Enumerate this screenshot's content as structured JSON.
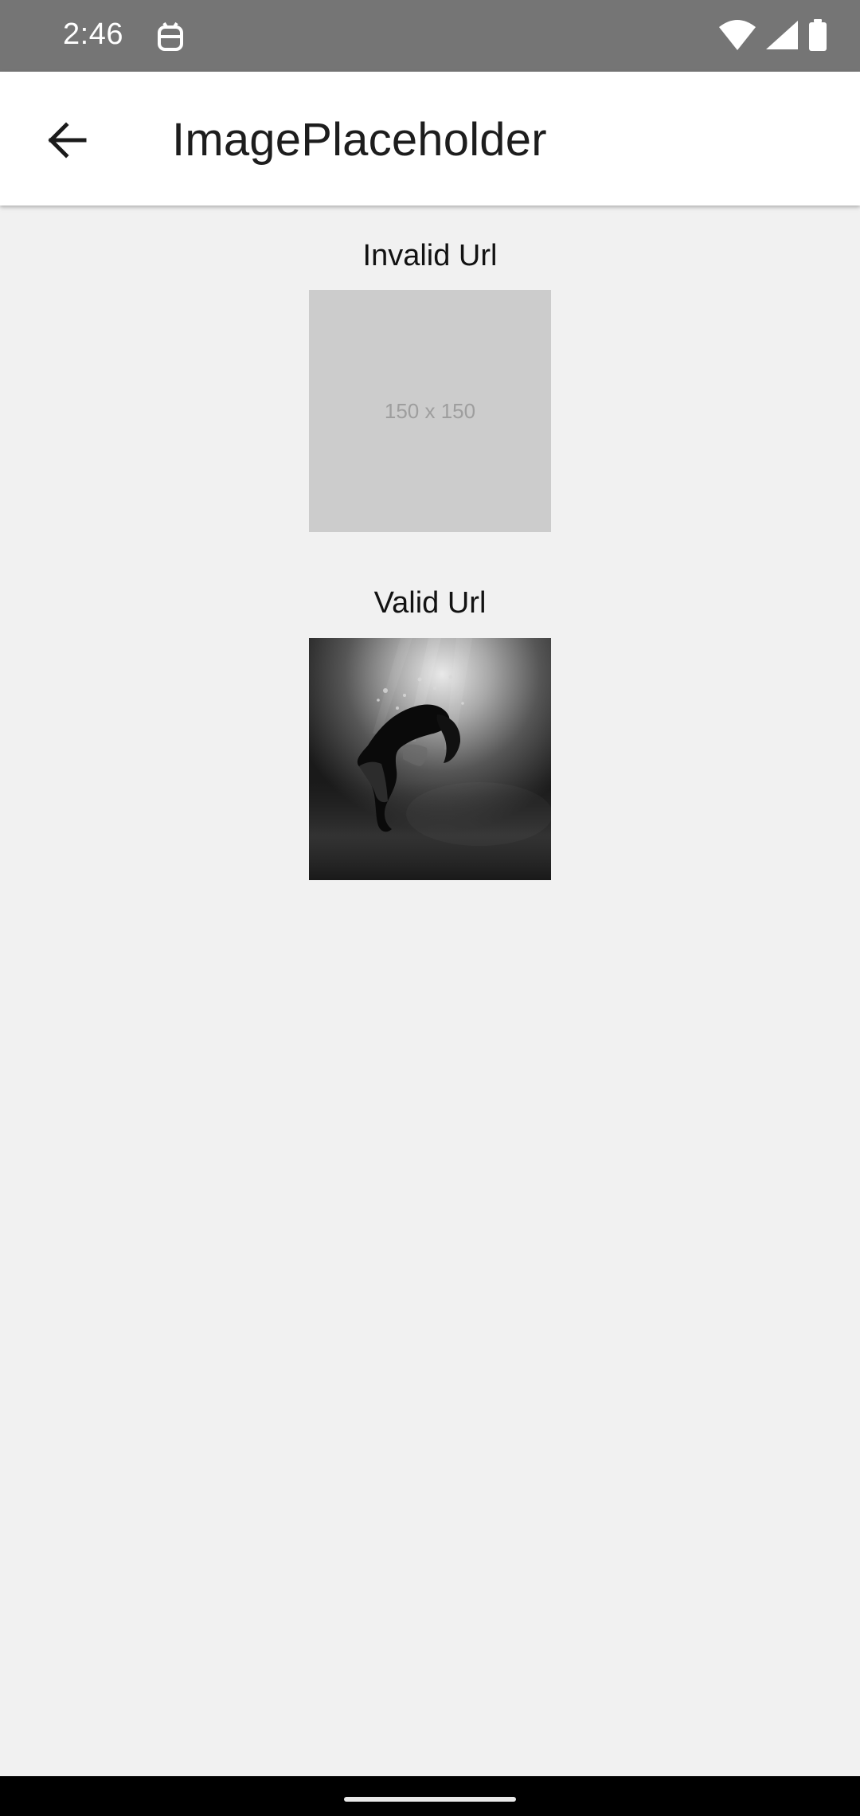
{
  "status_bar": {
    "time": "2:46",
    "app_icon": "android-debug-icon",
    "icons": [
      "wifi-icon",
      "cellular-signal-icon",
      "battery-icon"
    ]
  },
  "app_bar": {
    "title": "ImagePlaceholder",
    "back_icon": "arrow-back-icon"
  },
  "sections": [
    {
      "label": "Invalid Url",
      "placeholder_text": "150 x 150"
    },
    {
      "label": "Valid Url",
      "image_description_icon": "underwater-person-photo"
    }
  ],
  "colors": {
    "status_bar": "#757575",
    "app_bar": "#ffffff",
    "background": "#f1f1f1",
    "placeholder": "#cccccc",
    "placeholder_text": "#9e9e9e"
  }
}
